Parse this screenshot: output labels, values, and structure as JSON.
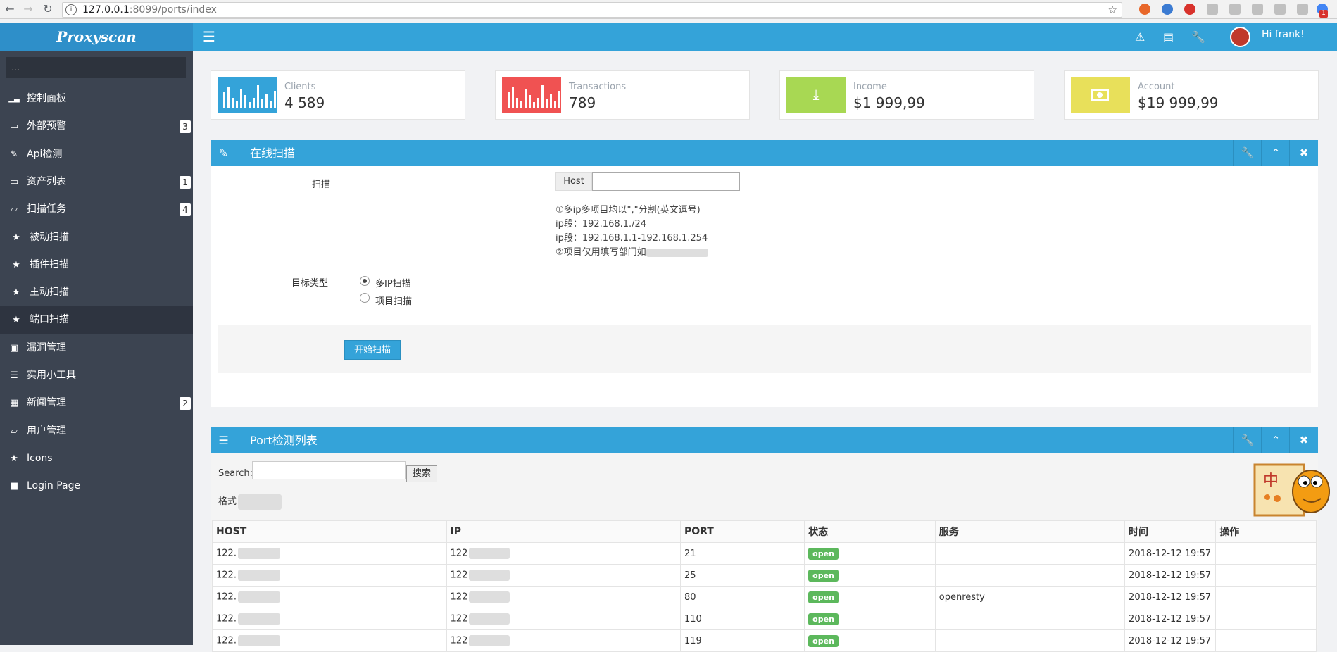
{
  "browser": {
    "url_host": "127.0.0.1",
    "url_rest": ":8099/ports/index",
    "ext_colors": [
      "#e8672a",
      "#3b7bd2",
      "#d8322c",
      "#9e9e9e",
      "#9e9e9e",
      "#9e9e9e",
      "#9e9e9e",
      "#9e9e9e",
      "#4285f4",
      "#d8322c"
    ],
    "badge": "1"
  },
  "brand": "Proxyscan",
  "sidebar": {
    "search_placeholder": "...",
    "items": [
      {
        "label": "控制面板",
        "icon": "bar-chart-icon",
        "badge": ""
      },
      {
        "label": "外部预警",
        "icon": "folder-icon",
        "badge": "3"
      },
      {
        "label": "Api检测",
        "icon": "edit-icon",
        "badge": ""
      },
      {
        "label": "资产列表",
        "icon": "folder-icon",
        "badge": "1"
      },
      {
        "label": "扫描任务",
        "icon": "folder-open-icon",
        "badge": "4"
      },
      {
        "label": "被动扫描",
        "icon": "star-icon",
        "badge": ""
      },
      {
        "label": "插件扫描",
        "icon": "star-icon",
        "badge": ""
      },
      {
        "label": "主动扫描",
        "icon": "star-icon",
        "badge": ""
      },
      {
        "label": "端口扫描",
        "icon": "star-icon",
        "badge": ""
      },
      {
        "label": "漏洞管理",
        "icon": "image-icon",
        "badge": ""
      },
      {
        "label": "实用小工具",
        "icon": "list-icon",
        "badge": ""
      },
      {
        "label": "新闻管理",
        "icon": "calendar-icon",
        "badge": "2"
      },
      {
        "label": "用户管理",
        "icon": "folder-open-icon",
        "badge": ""
      },
      {
        "label": "Icons",
        "icon": "star-icon",
        "badge": ""
      },
      {
        "label": "Login Page",
        "icon": "lock-icon",
        "badge": ""
      }
    ]
  },
  "topbar": {
    "greeting": "Hi frank!",
    "icons": [
      "warning-icon",
      "inbox-icon",
      "wrench-icon"
    ]
  },
  "stats": [
    {
      "label": "Clients",
      "value": "4 589",
      "color": "#34a3d9"
    },
    {
      "label": "Transactions",
      "value": "789",
      "color": "#f05252"
    },
    {
      "label": "Income",
      "value": "$1 999,99",
      "color": "#a8d853"
    },
    {
      "label": "Account",
      "value": "$19 999,99",
      "color": "#e8e05a"
    }
  ],
  "scan_panel": {
    "title": "在线扫描",
    "scan_label": "扫描",
    "host_addon": "Host",
    "host_value": "",
    "hint1": "①多ip多项目均以\",\"分割(英文逗号)",
    "hint2": "ip段：192.168.1./24",
    "hint3": "ip段：192.168.1.1-192.168.1.254",
    "hint4": "②项目仅用填写部门如",
    "target_label": "目标类型",
    "options": [
      "多IP扫描",
      "项目扫描"
    ],
    "selected_option": "多IP扫描",
    "start_button": "开始扫描"
  },
  "ports_panel": {
    "title": "Port检测列表",
    "search_label": "Search:",
    "search_value": "",
    "search_button": "搜索",
    "format_label": "格式",
    "columns": [
      "HOST",
      "IP",
      "PORT",
      "状态",
      "服务",
      "时间",
      "操作"
    ],
    "rows": [
      {
        "host": "122.",
        "ip": "122",
        "port": "21",
        "status": "open",
        "service": "",
        "time": "2018-12-12 19:57"
      },
      {
        "host": "122.",
        "ip": "122",
        "port": "25",
        "status": "open",
        "service": "",
        "time": "2018-12-12 19:57"
      },
      {
        "host": "122.",
        "ip": "122",
        "port": "80",
        "status": "open",
        "service": "openresty",
        "time": "2018-12-12 19:57"
      },
      {
        "host": "122.",
        "ip": "122",
        "port": "110",
        "status": "open",
        "service": "",
        "time": "2018-12-12 19:57"
      },
      {
        "host": "122.",
        "ip": "122",
        "port": "119",
        "status": "open",
        "service": "",
        "time": "2018-12-12 19:57"
      }
    ]
  },
  "widget": {
    "char": "中"
  }
}
